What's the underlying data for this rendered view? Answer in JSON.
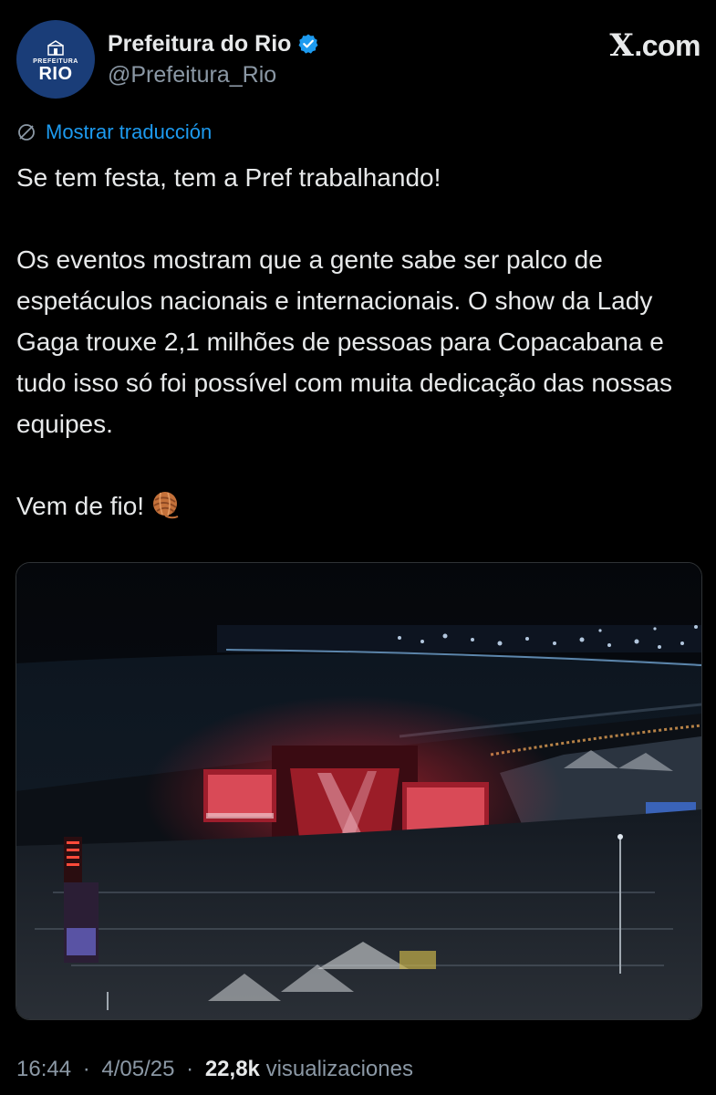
{
  "header": {
    "avatar": {
      "line1": "Prefeitura",
      "line2": "RIO"
    },
    "display_name": "Prefeitura do Rio",
    "handle": "@Prefeitura_Rio",
    "site_label": ".com",
    "site_glyph": "X",
    "verified_color": "#1d9bf0"
  },
  "translate": {
    "label": "Mostrar traducción",
    "icon": "translate-icon",
    "color": "#1d9bf0"
  },
  "tweet": {
    "line1": "Se tem festa, tem a Pref trabalhando!",
    "paragraph2": "Os eventos mostram que a gente sabe ser palco de espetáculos nacionais e internacionais. O show da Lady Gaga trouxe 2,1 milhões de pessoas para Copacabana e tudo isso só foi possível com muita dedicação das nossas equipes.",
    "line3": "Vem de fio!",
    "emoji": "yarn-ball-emoji"
  },
  "media": {
    "description_icon": "concert-photo"
  },
  "meta": {
    "time": "16:44",
    "separator": "·",
    "date": "4/05/25",
    "views_count": "22,8k",
    "views_label": "visualizaciones"
  },
  "colors": {
    "background": "#000000",
    "text_primary": "#e7e9ea",
    "text_secondary": "#8b98a5",
    "accent": "#1d9bf0"
  }
}
